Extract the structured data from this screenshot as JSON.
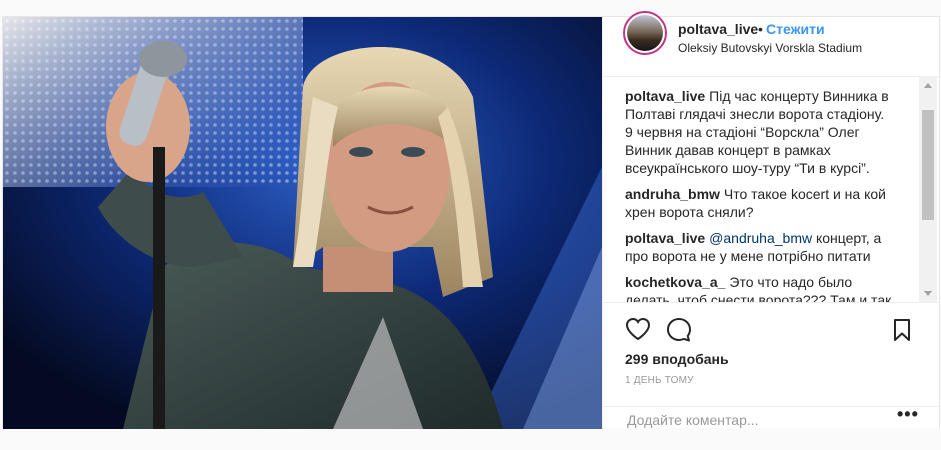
{
  "post": {
    "username": "poltava_live",
    "separator": "•",
    "follow_label": "Стежити",
    "location": "Oleksiy Butovskyi Vorskla Stadium",
    "photo_description_icon": "concert-photo",
    "comments": [
      {
        "author": "poltava_live",
        "text": "Під час концерту Винника в Полтаві глядачі знесли ворота стадіону. 9 червня на стадіоні “Ворскла” Олег Винник давав концерт в рамках всеукраїнського шоу-туру “Ти в курсі”."
      },
      {
        "author": "andruha_bmw",
        "text": "Что такое kocert и на кой хрен ворота сняли?"
      },
      {
        "author": "poltava_live",
        "mention": "@andruha_bmw",
        "text": " концерт, а про ворота не у мене потрібно питати"
      },
      {
        "author": "kochetkova_a_",
        "text": "Это что надо было делать, чтоб снести ворота??? Там и так клуб"
      }
    ],
    "likes": "299 вподобань",
    "time": "1 день тому",
    "add_comment_placeholder": "Додайте коментар...",
    "more_label": "•••"
  },
  "colors": {
    "follow": "#3897f0",
    "story_ring": "#c13584",
    "text": "#262626",
    "muted": "#999999"
  }
}
